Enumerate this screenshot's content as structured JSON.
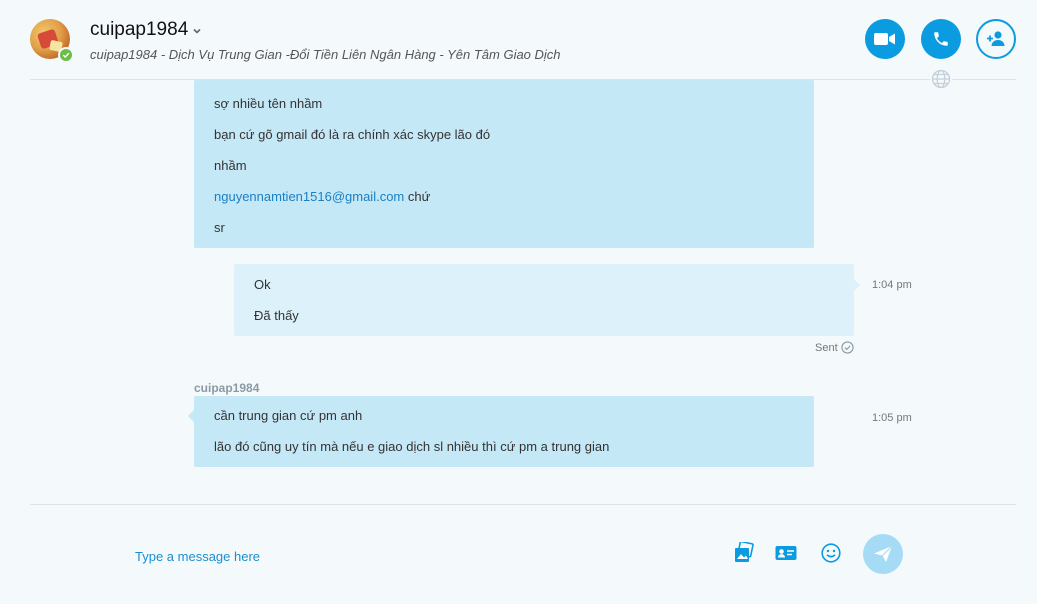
{
  "header": {
    "contact_name": "cuipap1984",
    "mood": "cuipap1984 - Dịch Vụ Trung Gian -Đổi Tiền Liên Ngân Hàng - Yên Tâm Giao Dịch",
    "presence": "online",
    "buttons": [
      "video-call",
      "audio-call",
      "add-people"
    ]
  },
  "messages": [
    {
      "direction": "incoming",
      "lines": [
        "sợ nhiều tên nhầm",
        "bạn cứ gõ gmail đó là ra chính xác skype lão đó",
        "nhầm"
      ],
      "link_line": {
        "link": "nguyennamtien1516@gmail.com",
        "suffix": " chứ"
      },
      "last_line": "sr"
    },
    {
      "direction": "outgoing",
      "time": "1:04 pm",
      "lines": [
        "Ok",
        "Đã thấy"
      ],
      "status": "Sent"
    },
    {
      "direction": "incoming",
      "sender": "cuipap1984",
      "time": "1:05 pm",
      "lines": [
        "cần trung gian cứ pm anh",
        "lão đó cũng uy tín mà nếu e giao dịch sl nhiều thì cứ pm a trung gian"
      ]
    }
  ],
  "composer": {
    "placeholder": "Type a message here"
  },
  "colors": {
    "accent": "#0a9be0",
    "incoming_bubble": "#c5e8f7",
    "outgoing_bubble": "#ddf1fa",
    "presence_online": "#6bbd45",
    "send_button": "#a6dbf5"
  }
}
